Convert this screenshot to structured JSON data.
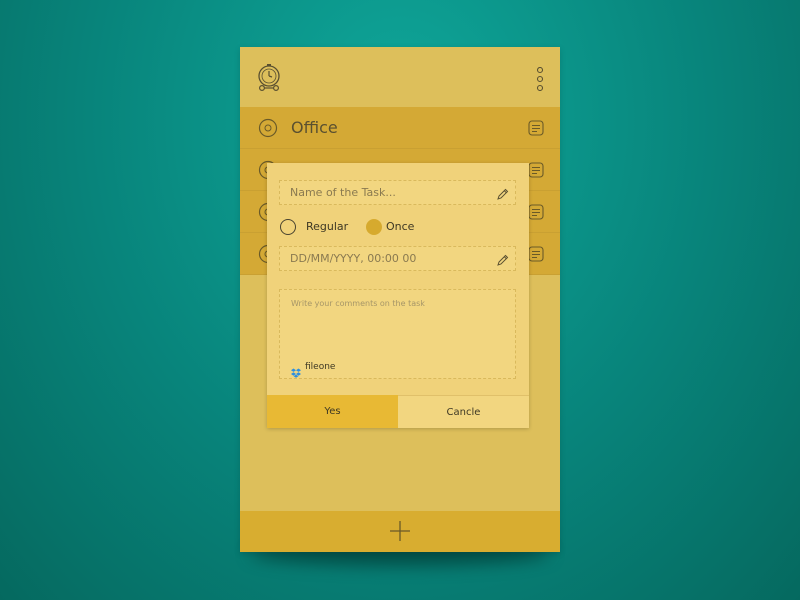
{
  "list": {
    "items": [
      {
        "label": "Office"
      },
      {
        "label": ""
      },
      {
        "label": ""
      },
      {
        "label": ""
      }
    ]
  },
  "dialog": {
    "task_name_placeholder": "Name of the Task...",
    "frequency_options": [
      {
        "label": "Regular",
        "selected": false
      },
      {
        "label": "Once",
        "selected": true
      }
    ],
    "datetime_placeholder": "DD/MM/YYYY, 00:00 00",
    "comments_placeholder": "Write your comments on the task",
    "attachment_label": "fileone",
    "yes_label": "Yes",
    "cancel_label": "Cancle"
  },
  "colors": {
    "background": "#08847b",
    "card": "#ddbf5b",
    "row": "#d4a935",
    "dialog": "#f0d27a",
    "accent": "#e8b934",
    "dropbox": "#2d8fe0"
  },
  "icons": [
    "clock-icon",
    "menu-icon",
    "circle-icon",
    "note-icon",
    "pencil-icon",
    "dropbox-icon",
    "plus-icon"
  ]
}
